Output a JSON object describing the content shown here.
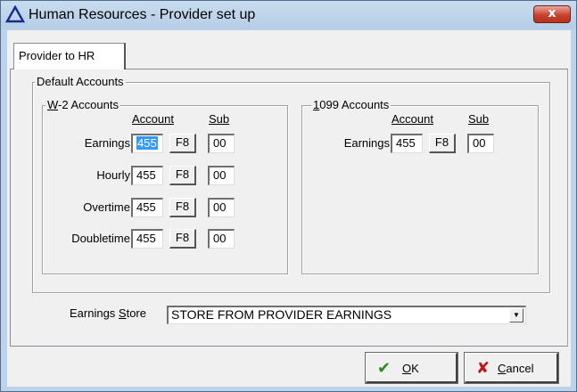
{
  "window": {
    "title": "Human Resources - Provider set up",
    "close_label": "x"
  },
  "tabs": [
    {
      "label": "Provider to HR",
      "active": true
    }
  ],
  "default_accounts": {
    "legend": "Default Accounts",
    "w2": {
      "legend_underlined": "W",
      "legend_rest": "-2 Accounts",
      "account_header": "Account",
      "sub_header": "Sub",
      "rows": [
        {
          "label": "Earnings",
          "account": "455",
          "lookup": "F8",
          "sub": "00",
          "selected": true
        },
        {
          "label": "Hourly",
          "account": "455",
          "lookup": "F8",
          "sub": "00"
        },
        {
          "label": "Overtime",
          "account": "455",
          "lookup": "F8",
          "sub": "00"
        },
        {
          "label": "Doubletime",
          "account": "455",
          "lookup": "F8",
          "sub": "00"
        }
      ]
    },
    "ten99": {
      "legend_underlined": "1",
      "legend_rest": "099 Accounts",
      "account_header": "Account",
      "sub_header": "Sub",
      "rows": [
        {
          "label": "Earnings",
          "account": "455",
          "lookup": "F8",
          "sub": "00"
        }
      ]
    }
  },
  "earnings_store": {
    "label_before": "Earnings ",
    "label_underlined": "S",
    "label_after": "tore",
    "value": "STORE FROM PROVIDER EARNINGS"
  },
  "buttons": {
    "ok": {
      "underlined": "O",
      "rest": "K"
    },
    "cancel": {
      "underlined": "C",
      "rest": "ancel"
    }
  },
  "colors": {
    "frame": "#bcd3ea",
    "client": "#f0f0f0",
    "selection": "#3399ff",
    "ok_check": "#2e8b20",
    "cancel_x": "#c01818"
  }
}
